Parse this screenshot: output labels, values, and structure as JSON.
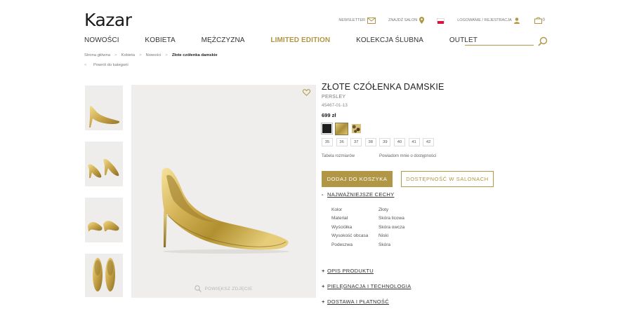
{
  "header": {
    "logo": "Kazar",
    "newsletter": "NEWSLETTER",
    "find_store": "ZNAJDŹ SALON",
    "login": "LOGOWANIE / REJESTRACJA",
    "cart_count": "0"
  },
  "nav": {
    "items": [
      "NOWOŚCI",
      "KOBIETA",
      "MĘŻCZYZNA",
      "LIMITED EDITION",
      "KOLEKCJA ŚLUBNA",
      "OUTLET"
    ],
    "search_placeholder": ""
  },
  "breadcrumb": {
    "items": [
      "Strona główna",
      "Kobieta",
      "Nowości"
    ],
    "current": "Złote czółenka damskie",
    "back": "Powrót do kategorii"
  },
  "gallery": {
    "zoom_label": "POWIĘKSZ ZDJĘCIE"
  },
  "product": {
    "title": "ZŁOTE CZÓŁENKA DAMSKIE",
    "brand": "PERSLEY",
    "sku": "45467-01-13",
    "price": "699 zł",
    "colors": [
      "#1e1e1e",
      "#c9ab55",
      "#d8c07a"
    ],
    "sizes": [
      "35",
      "36",
      "37",
      "38",
      "39",
      "40",
      "41",
      "42"
    ],
    "size_chart": "Tabela rozmiarów",
    "notify": "Powiadom mnie o dostępności",
    "add_to_cart": "DODAJ DO KOSZYKA",
    "availability": "DOSTĘPNOŚĆ W SALONACH"
  },
  "features": {
    "title": "NAJWAŻNIEJSZE CECHY",
    "rows": [
      {
        "key": "Kolor",
        "value": "Złoty"
      },
      {
        "key": "Materiał",
        "value": "Skóra licowa"
      },
      {
        "key": "Wyściółka",
        "value": "Skóra owcza"
      },
      {
        "key": "Wysokość obcasa",
        "value": "Niski"
      },
      {
        "key": "Podeszwa",
        "value": "Skóra"
      }
    ]
  },
  "sections": {
    "description": "OPIS PRODUKTU",
    "care": "PIELĘGNACJA I TECHNOLOGIA",
    "delivery": "DOSTAWA I PŁATNOŚĆ"
  },
  "theme": {
    "accent": "#b09645",
    "text": "#333333",
    "bg_image": "#efeeec"
  }
}
